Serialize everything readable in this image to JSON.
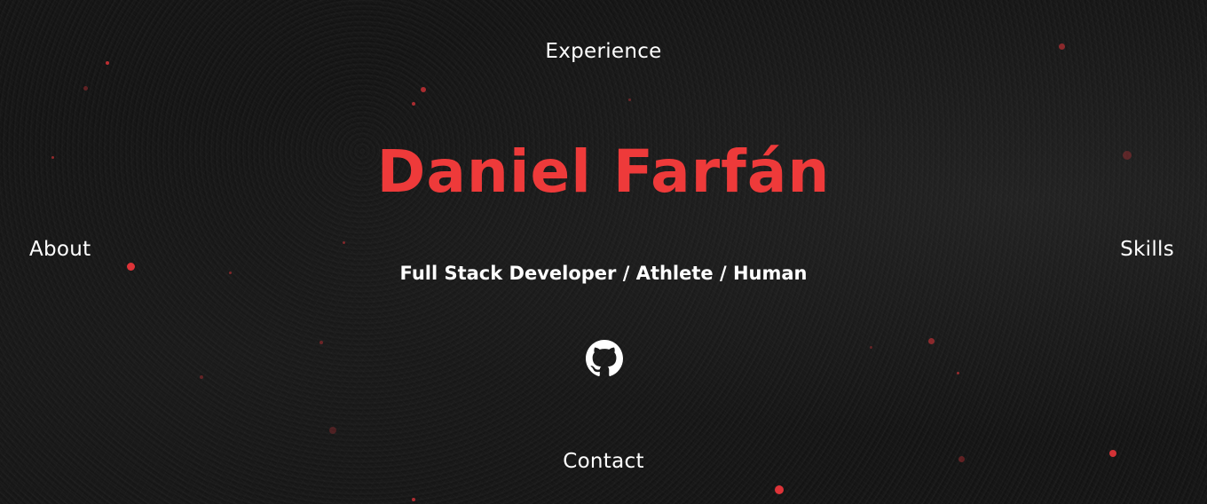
{
  "nav": {
    "top_label": "Experience",
    "left_label": "About",
    "right_label": "Skills",
    "bottom_label": "Contact"
  },
  "hero": {
    "title": "Daniel Farfán",
    "subtitle": "Full Stack Developer / Athlete / Human"
  },
  "social": {
    "github_icon": "github-icon"
  },
  "colors": {
    "accent": "#ee3a3a",
    "background": "#141414",
    "text": "#ffffff"
  }
}
